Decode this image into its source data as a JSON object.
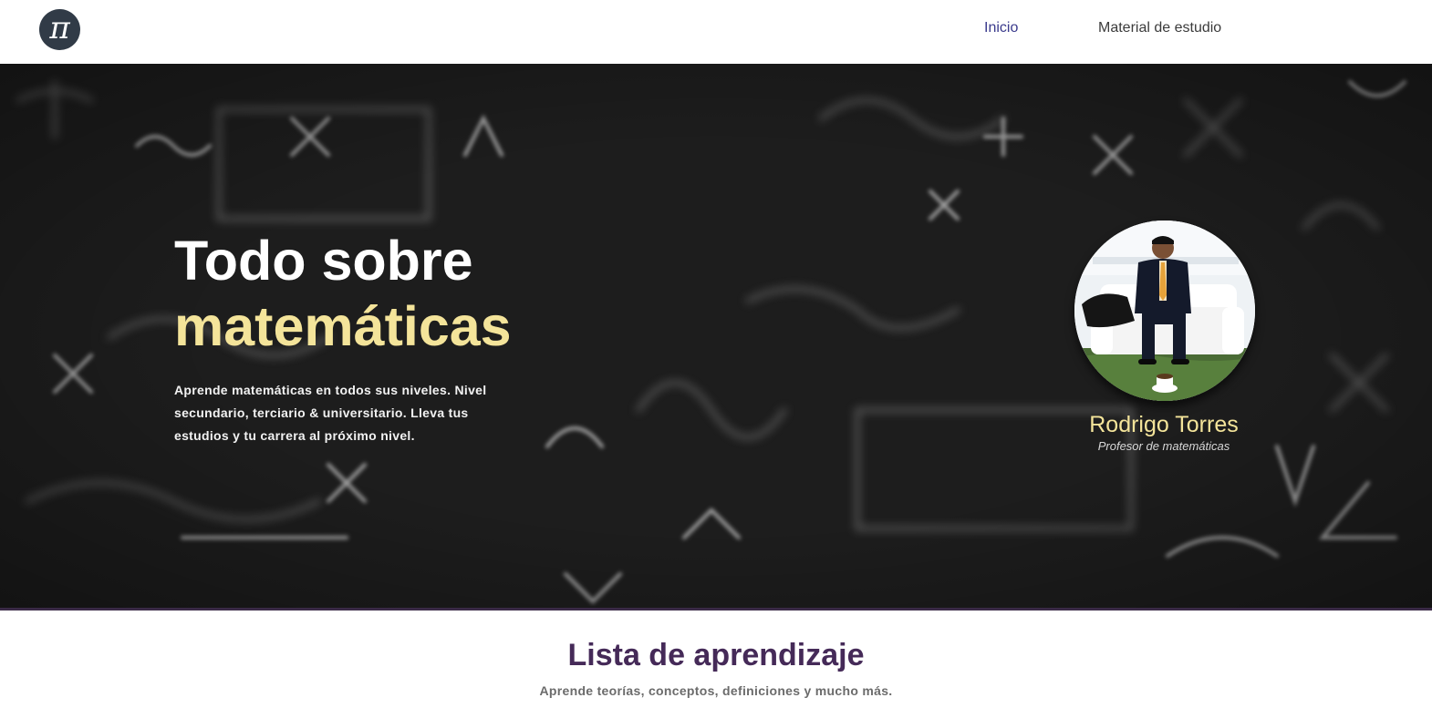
{
  "nav": {
    "logo_icon": "pi-icon",
    "logo_glyph": "π",
    "inicio_label": "Inicio",
    "material_label": "Material de estudio"
  },
  "hero": {
    "title_line1": "Todo sobre",
    "title_line2": "matemáticas",
    "description": "Aprende matemáticas en todos sus niveles. Nivel secundario, terciario & universitario. Lleva tus estudios y tu carrera al próximo nivel.",
    "background": "chalkboard-formulas-image"
  },
  "profile": {
    "name": "Rodrigo Torres",
    "role": "Profesor de matemáticas",
    "photo": "teacher-portrait-photo"
  },
  "section": {
    "title": "Lista de aprendizaje",
    "subtitle": "Aprende teorías, conceptos, definiciones y mucho más."
  },
  "colors": {
    "accent_yellow": "#f4e49a",
    "nav_active": "#3a3a8c",
    "section_title": "#452a58",
    "logo_bg": "#313b47"
  }
}
